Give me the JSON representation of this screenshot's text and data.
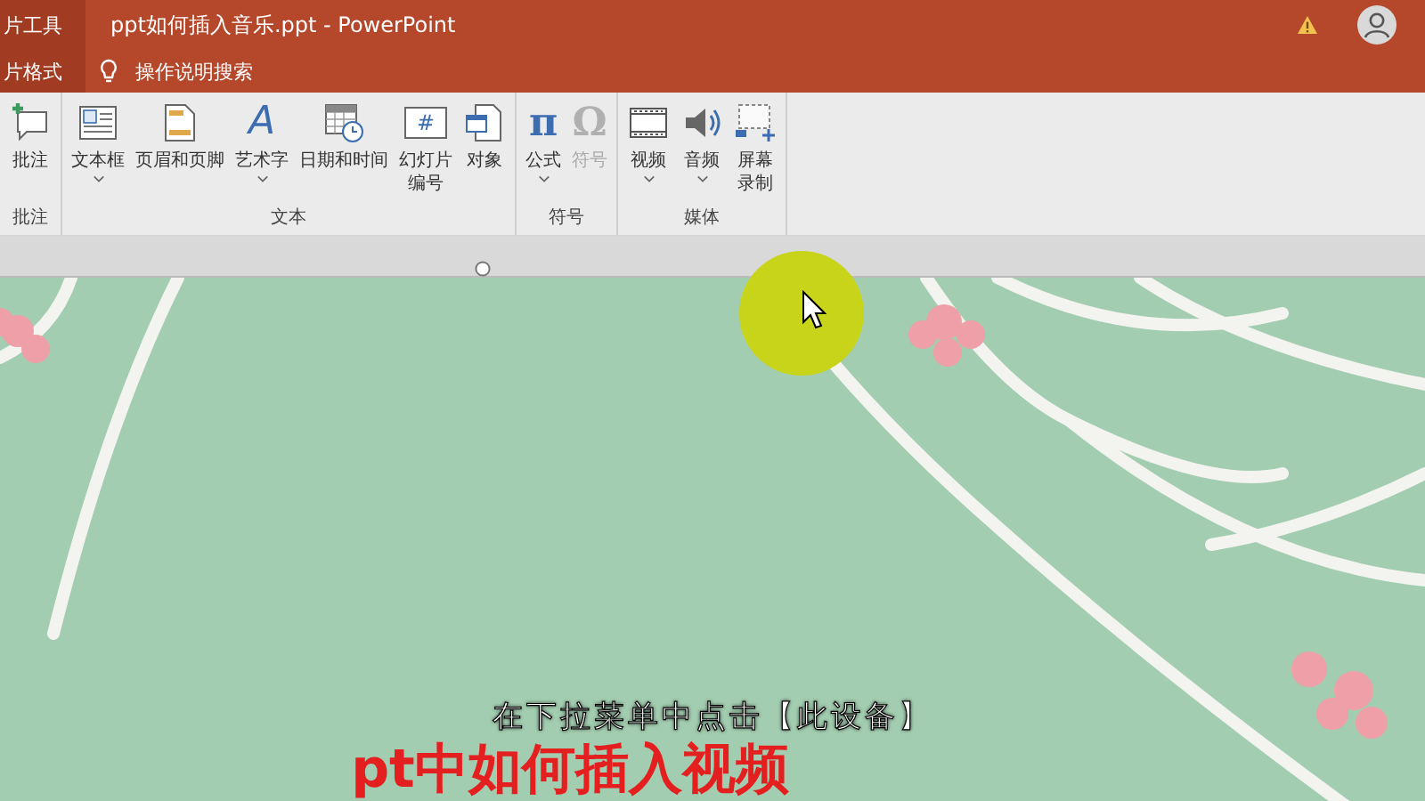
{
  "title_bar": {
    "context_tab": "片工具",
    "title": "ppt如何插入音乐.ppt  -  PowerPoint"
  },
  "tab_row": {
    "context_tab": "片格式",
    "search": "操作说明搜索"
  },
  "ribbon": {
    "groups": [
      {
        "label": "批注",
        "items": [
          {
            "kind": "comment",
            "lines": [
              "批注"
            ],
            "dropdown": false,
            "disabled": false
          }
        ]
      },
      {
        "label": "文本",
        "items": [
          {
            "kind": "textbox",
            "lines": [
              "文本框"
            ],
            "dropdown": true,
            "disabled": false
          },
          {
            "kind": "header",
            "lines": [
              "页眉和页脚"
            ],
            "dropdown": false,
            "disabled": false
          },
          {
            "kind": "wordart",
            "glyph": "A",
            "lines": [
              "艺术字"
            ],
            "dropdown": true,
            "disabled": false
          },
          {
            "kind": "datetime",
            "lines": [
              "日期和时间"
            ],
            "dropdown": false,
            "disabled": false
          },
          {
            "kind": "slidenum",
            "glyph": "#",
            "lines": [
              "幻灯片",
              "编号"
            ],
            "dropdown": false,
            "disabled": false
          },
          {
            "kind": "object",
            "lines": [
              "对象"
            ],
            "dropdown": false,
            "disabled": false
          }
        ]
      },
      {
        "label": "符号",
        "items": [
          {
            "kind": "equation",
            "glyph": "π",
            "lines": [
              "公式"
            ],
            "dropdown": true,
            "disabled": false
          },
          {
            "kind": "symbol",
            "glyph": "Ω",
            "lines": [
              "符号"
            ],
            "dropdown": false,
            "disabled": true
          }
        ]
      },
      {
        "label": "媒体",
        "items": [
          {
            "kind": "video",
            "lines": [
              "视频"
            ],
            "dropdown": true,
            "disabled": false
          },
          {
            "kind": "audio",
            "lines": [
              "音频"
            ],
            "dropdown": true,
            "disabled": false
          },
          {
            "kind": "screenrec",
            "lines": [
              "屏幕",
              "录制"
            ],
            "dropdown": false,
            "disabled": false
          }
        ]
      }
    ]
  },
  "slide": {
    "caption": "在下拉菜单中点击【此设备】",
    "title": "pt中如何插入视频"
  }
}
